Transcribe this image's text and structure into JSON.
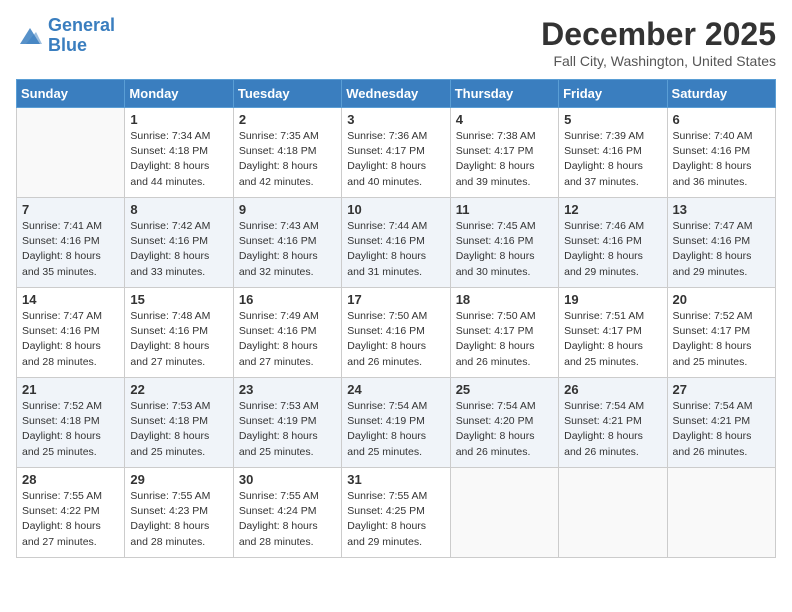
{
  "header": {
    "logo_line1": "General",
    "logo_line2": "Blue",
    "month": "December 2025",
    "location": "Fall City, Washington, United States"
  },
  "weekdays": [
    "Sunday",
    "Monday",
    "Tuesday",
    "Wednesday",
    "Thursday",
    "Friday",
    "Saturday"
  ],
  "weeks": [
    [
      {
        "day": "",
        "sunrise": "",
        "sunset": "",
        "daylight": ""
      },
      {
        "day": "1",
        "sunrise": "Sunrise: 7:34 AM",
        "sunset": "Sunset: 4:18 PM",
        "daylight": "Daylight: 8 hours and 44 minutes."
      },
      {
        "day": "2",
        "sunrise": "Sunrise: 7:35 AM",
        "sunset": "Sunset: 4:18 PM",
        "daylight": "Daylight: 8 hours and 42 minutes."
      },
      {
        "day": "3",
        "sunrise": "Sunrise: 7:36 AM",
        "sunset": "Sunset: 4:17 PM",
        "daylight": "Daylight: 8 hours and 40 minutes."
      },
      {
        "day": "4",
        "sunrise": "Sunrise: 7:38 AM",
        "sunset": "Sunset: 4:17 PM",
        "daylight": "Daylight: 8 hours and 39 minutes."
      },
      {
        "day": "5",
        "sunrise": "Sunrise: 7:39 AM",
        "sunset": "Sunset: 4:16 PM",
        "daylight": "Daylight: 8 hours and 37 minutes."
      },
      {
        "day": "6",
        "sunrise": "Sunrise: 7:40 AM",
        "sunset": "Sunset: 4:16 PM",
        "daylight": "Daylight: 8 hours and 36 minutes."
      }
    ],
    [
      {
        "day": "7",
        "sunrise": "Sunrise: 7:41 AM",
        "sunset": "Sunset: 4:16 PM",
        "daylight": "Daylight: 8 hours and 35 minutes."
      },
      {
        "day": "8",
        "sunrise": "Sunrise: 7:42 AM",
        "sunset": "Sunset: 4:16 PM",
        "daylight": "Daylight: 8 hours and 33 minutes."
      },
      {
        "day": "9",
        "sunrise": "Sunrise: 7:43 AM",
        "sunset": "Sunset: 4:16 PM",
        "daylight": "Daylight: 8 hours and 32 minutes."
      },
      {
        "day": "10",
        "sunrise": "Sunrise: 7:44 AM",
        "sunset": "Sunset: 4:16 PM",
        "daylight": "Daylight: 8 hours and 31 minutes."
      },
      {
        "day": "11",
        "sunrise": "Sunrise: 7:45 AM",
        "sunset": "Sunset: 4:16 PM",
        "daylight": "Daylight: 8 hours and 30 minutes."
      },
      {
        "day": "12",
        "sunrise": "Sunrise: 7:46 AM",
        "sunset": "Sunset: 4:16 PM",
        "daylight": "Daylight: 8 hours and 29 minutes."
      },
      {
        "day": "13",
        "sunrise": "Sunrise: 7:47 AM",
        "sunset": "Sunset: 4:16 PM",
        "daylight": "Daylight: 8 hours and 29 minutes."
      }
    ],
    [
      {
        "day": "14",
        "sunrise": "Sunrise: 7:47 AM",
        "sunset": "Sunset: 4:16 PM",
        "daylight": "Daylight: 8 hours and 28 minutes."
      },
      {
        "day": "15",
        "sunrise": "Sunrise: 7:48 AM",
        "sunset": "Sunset: 4:16 PM",
        "daylight": "Daylight: 8 hours and 27 minutes."
      },
      {
        "day": "16",
        "sunrise": "Sunrise: 7:49 AM",
        "sunset": "Sunset: 4:16 PM",
        "daylight": "Daylight: 8 hours and 27 minutes."
      },
      {
        "day": "17",
        "sunrise": "Sunrise: 7:50 AM",
        "sunset": "Sunset: 4:16 PM",
        "daylight": "Daylight: 8 hours and 26 minutes."
      },
      {
        "day": "18",
        "sunrise": "Sunrise: 7:50 AM",
        "sunset": "Sunset: 4:17 PM",
        "daylight": "Daylight: 8 hours and 26 minutes."
      },
      {
        "day": "19",
        "sunrise": "Sunrise: 7:51 AM",
        "sunset": "Sunset: 4:17 PM",
        "daylight": "Daylight: 8 hours and 25 minutes."
      },
      {
        "day": "20",
        "sunrise": "Sunrise: 7:52 AM",
        "sunset": "Sunset: 4:17 PM",
        "daylight": "Daylight: 8 hours and 25 minutes."
      }
    ],
    [
      {
        "day": "21",
        "sunrise": "Sunrise: 7:52 AM",
        "sunset": "Sunset: 4:18 PM",
        "daylight": "Daylight: 8 hours and 25 minutes."
      },
      {
        "day": "22",
        "sunrise": "Sunrise: 7:53 AM",
        "sunset": "Sunset: 4:18 PM",
        "daylight": "Daylight: 8 hours and 25 minutes."
      },
      {
        "day": "23",
        "sunrise": "Sunrise: 7:53 AM",
        "sunset": "Sunset: 4:19 PM",
        "daylight": "Daylight: 8 hours and 25 minutes."
      },
      {
        "day": "24",
        "sunrise": "Sunrise: 7:54 AM",
        "sunset": "Sunset: 4:19 PM",
        "daylight": "Daylight: 8 hours and 25 minutes."
      },
      {
        "day": "25",
        "sunrise": "Sunrise: 7:54 AM",
        "sunset": "Sunset: 4:20 PM",
        "daylight": "Daylight: 8 hours and 26 minutes."
      },
      {
        "day": "26",
        "sunrise": "Sunrise: 7:54 AM",
        "sunset": "Sunset: 4:21 PM",
        "daylight": "Daylight: 8 hours and 26 minutes."
      },
      {
        "day": "27",
        "sunrise": "Sunrise: 7:54 AM",
        "sunset": "Sunset: 4:21 PM",
        "daylight": "Daylight: 8 hours and 26 minutes."
      }
    ],
    [
      {
        "day": "28",
        "sunrise": "Sunrise: 7:55 AM",
        "sunset": "Sunset: 4:22 PM",
        "daylight": "Daylight: 8 hours and 27 minutes."
      },
      {
        "day": "29",
        "sunrise": "Sunrise: 7:55 AM",
        "sunset": "Sunset: 4:23 PM",
        "daylight": "Daylight: 8 hours and 28 minutes."
      },
      {
        "day": "30",
        "sunrise": "Sunrise: 7:55 AM",
        "sunset": "Sunset: 4:24 PM",
        "daylight": "Daylight: 8 hours and 28 minutes."
      },
      {
        "day": "31",
        "sunrise": "Sunrise: 7:55 AM",
        "sunset": "Sunset: 4:25 PM",
        "daylight": "Daylight: 8 hours and 29 minutes."
      },
      {
        "day": "",
        "sunrise": "",
        "sunset": "",
        "daylight": ""
      },
      {
        "day": "",
        "sunrise": "",
        "sunset": "",
        "daylight": ""
      },
      {
        "day": "",
        "sunrise": "",
        "sunset": "",
        "daylight": ""
      }
    ]
  ]
}
